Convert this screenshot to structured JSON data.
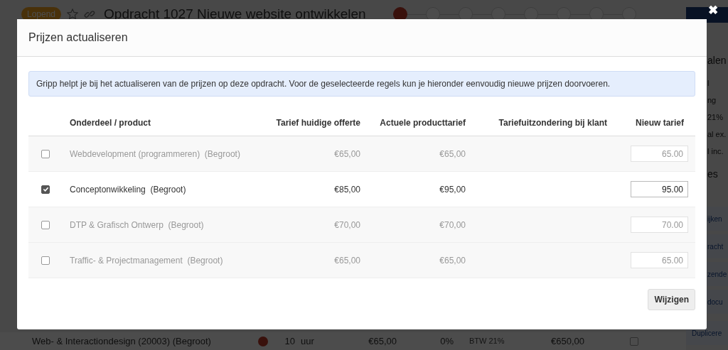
{
  "page": {
    "status_badge": "Lopend",
    "title": "Opdracht 1027 Nieuwe website ontwikkelen",
    "progress_steps": [
      {
        "done": true
      },
      {
        "done": false
      },
      {
        "done": false
      },
      {
        "done": false
      },
      {
        "done": false
      },
      {
        "done": false
      },
      {
        "done": false
      },
      {
        "done": false
      }
    ],
    "side_panel": {
      "texts": [
        {
          "kind": "heading",
          "text": "alen"
        },
        {
          "kind": "label",
          "text": "l"
        },
        {
          "kind": "label",
          "text": "ng"
        },
        {
          "kind": "label",
          "text": "21%"
        },
        {
          "kind": "label",
          "text": "al ex."
        },
        {
          "kind": "label",
          "text": "l inc."
        },
        {
          "kind": "heading",
          "text": "es"
        }
      ],
      "buttons": [
        "ijken",
        "racht",
        "zende",
        "docu",
        "Duplicere"
      ]
    },
    "line_item": {
      "name": "Web- & Interactiondesign (20003) (Begroot)",
      "quantity": "10",
      "unit": "uur",
      "rate": "€65,00",
      "discount": "0%",
      "vat": "BTW 21%",
      "total": "€650,00",
      "checked": false
    }
  },
  "modal": {
    "title": "Prijzen actualiseren",
    "info": "Gripp helpt je bij het actualiseren van de prijzen op deze opdracht. Voor de geselecteerde regels kun je hieronder eenvoudig nieuwe prijzen doorvoeren.",
    "columns": [
      "Onderdeel / product",
      "Tarief huidige offerte",
      "Actuele producttarief",
      "Tariefuitzondering bij klant",
      "Nieuw tarief"
    ],
    "rows": [
      {
        "product": "Webdevelopment (programmeren)  (Begroot)",
        "quote_rate": "€65,00",
        "product_rate": "€65,00",
        "new_rate": "65.00",
        "checked": false
      },
      {
        "product": "Conceptonwikkeling  (Begroot)",
        "quote_rate": "€85,00",
        "product_rate": "€95,00",
        "new_rate": "95.00",
        "checked": true
      },
      {
        "product": "DTP & Grafisch Ontwerp  (Begroot)",
        "quote_rate": "€70,00",
        "product_rate": "€70,00",
        "new_rate": "70.00",
        "checked": false
      },
      {
        "product": "Traffic- & Projectmanagement  (Begroot)",
        "quote_rate": "€65,00",
        "product_rate": "€65,00",
        "new_rate": "65.00",
        "checked": false
      }
    ],
    "submit": "Wijzigen",
    "close": "✖"
  }
}
